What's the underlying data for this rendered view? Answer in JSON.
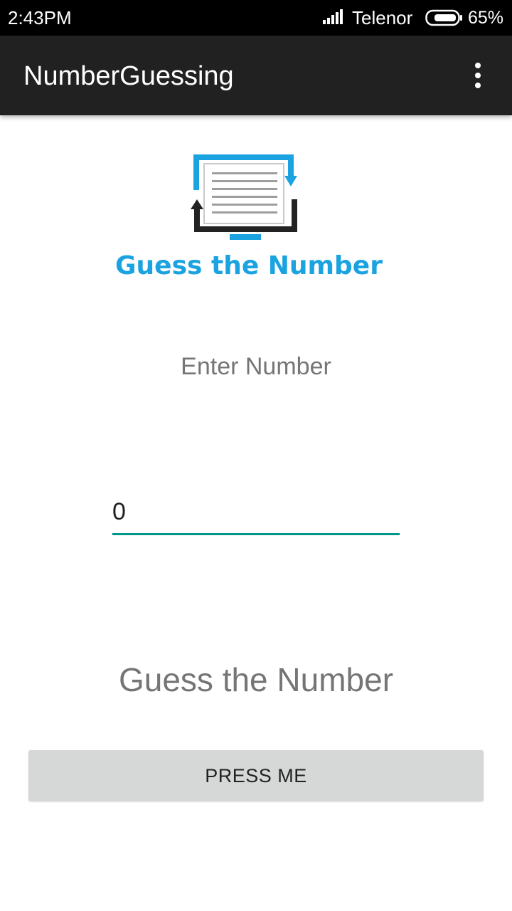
{
  "status_bar": {
    "time": "2:43PM",
    "carrier": "Telenor",
    "battery": "65%",
    "icons": [
      "signal-icon",
      "battery-icon"
    ]
  },
  "app_bar": {
    "title": "NumberGuessing",
    "menu_icon": "overflow-menu-icon",
    "background": "#212121"
  },
  "logo": {
    "text": "Guess the Number",
    "icon": "document-refresh-icon",
    "accent": "#1aa3e0"
  },
  "form": {
    "label": "Enter Number",
    "input_value": "0",
    "underline_color": "#009688"
  },
  "result": {
    "text": "Guess the Number"
  },
  "button": {
    "label": "PRESS ME",
    "background": "#d6d7d7"
  }
}
